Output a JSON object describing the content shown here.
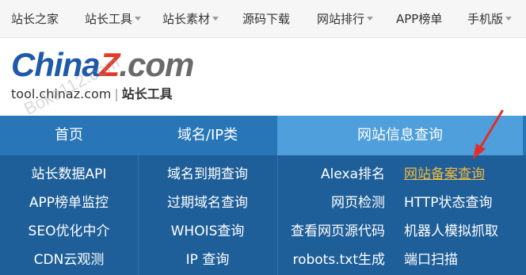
{
  "topnav": {
    "items": [
      {
        "label": "站长之家",
        "has_caret": false
      },
      {
        "label": "站长工具",
        "has_caret": true
      },
      {
        "label": "站长素材",
        "has_caret": true
      },
      {
        "label": "源码下载",
        "has_caret": false
      },
      {
        "label": "网站排行",
        "has_caret": true
      },
      {
        "label": "APP榜单",
        "has_caret": false
      },
      {
        "label": "手机版",
        "has_caret": true
      }
    ]
  },
  "logo": {
    "part1": "China",
    "part2": "Z",
    "part3": ".com",
    "domain": "tool.chinaz.com",
    "separator": "|",
    "tagline": "站长工具"
  },
  "watermark": {
    "text1": "Boke112.com",
    "text2": "Boke112.com"
  },
  "menu": {
    "tabs": [
      {
        "label": "首页",
        "active": false
      },
      {
        "label": "域名/IP类",
        "active": false
      },
      {
        "label": "网站信息查询",
        "active": true
      }
    ],
    "col1": [
      "站长数据API",
      "APP榜单监控",
      "SEO优化中介",
      "CDN云观测"
    ],
    "col2": [
      "域名到期查询",
      "过期域名查询",
      "WHOIS查询",
      "IP 查询"
    ],
    "col3a": [
      "Alexa排名",
      "网页检测",
      "查看网页源代码",
      "robots.txt生成"
    ],
    "col3b": [
      "网站备案查询",
      "HTTP状态查询",
      "机器人模拟抓取",
      "端口扫描"
    ],
    "highlighted_item": "网站备案查询"
  },
  "colors": {
    "menu_bg": "#1f5f99",
    "tab_bar": "#2876b8",
    "active_tab": "#4f9fdc",
    "highlight_text": "#f4b93d",
    "arrow": "#e0302a"
  }
}
